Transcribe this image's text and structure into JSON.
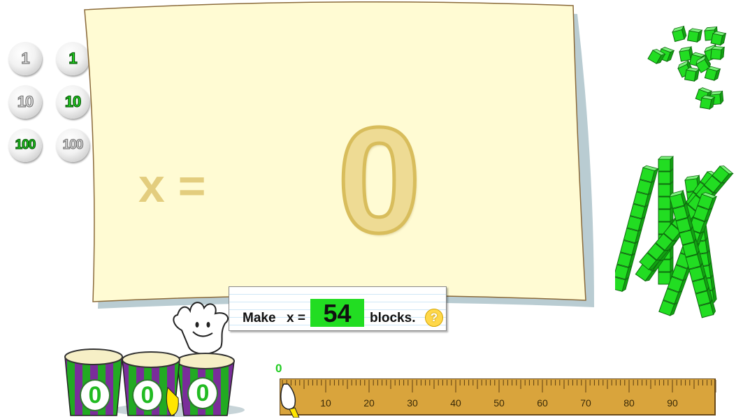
{
  "coins": {
    "rows": [
      [
        {
          "label": "1",
          "style": "grey"
        },
        {
          "label": "1",
          "style": "green"
        }
      ],
      [
        {
          "label": "10",
          "style": "grey"
        },
        {
          "label": "10",
          "style": "green"
        }
      ],
      [
        {
          "label": "100",
          "style": "green"
        },
        {
          "label": "100",
          "style": "grey"
        }
      ]
    ]
  },
  "expression": {
    "variable_label": "x =",
    "current_value": "0"
  },
  "prompt": {
    "make_label": "Make",
    "x_label": "x =",
    "target_value": "54",
    "blocks_label": "blocks.",
    "help_label": "?"
  },
  "drums": {
    "digits": [
      "0",
      "0",
      "0"
    ]
  },
  "counter": {
    "value": "0"
  },
  "ruler": {
    "ticks": [
      "10",
      "20",
      "30",
      "40",
      "50",
      "60",
      "70",
      "80",
      "90"
    ]
  },
  "colors": {
    "block_green": "#22dd22",
    "sheet": "#fffbd3",
    "ruler": "#d9a43c",
    "drum_purple": "#7a2d9a"
  }
}
